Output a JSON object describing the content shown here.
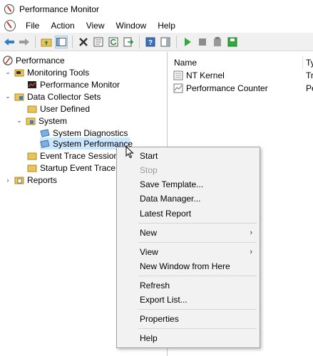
{
  "window": {
    "title": "Performance Monitor"
  },
  "menubar": {
    "items": [
      "File",
      "Action",
      "View",
      "Window",
      "Help"
    ]
  },
  "toolbar": {
    "buttons": [
      "back-arrow-icon",
      "forward-arrow-icon",
      "up-folder-icon",
      "show-hide-tree-icon",
      "delete-icon",
      "properties-icon",
      "refresh-icon",
      "export-icon",
      "help-icon",
      "show-hide-action-pane-icon",
      "start-icon",
      "stop-icon",
      "delete-set-icon",
      "save-template-icon"
    ]
  },
  "tree": {
    "items": [
      {
        "label": "Performance",
        "icon": "perfmon-icon",
        "expander": ""
      },
      {
        "label": "Monitoring Tools",
        "icon": "tools-folder-icon",
        "expander": "expanded"
      },
      {
        "label": "Performance Monitor",
        "icon": "graph-icon",
        "expander": ""
      },
      {
        "label": "Data Collector Sets",
        "icon": "collector-folder-icon",
        "expander": "expanded"
      },
      {
        "label": "User Defined",
        "icon": "folder-icon",
        "expander": ""
      },
      {
        "label": "System",
        "icon": "folder-icon",
        "expander": "expanded"
      },
      {
        "label": "System Diagnostics",
        "icon": "collector-set-icon",
        "expander": ""
      },
      {
        "label": "System Performance",
        "icon": "collector-set-icon",
        "expander": ""
      },
      {
        "label": "Event Trace Sessions",
        "icon": "folder-icon",
        "expander": ""
      },
      {
        "label": "Startup Event Trace Se",
        "icon": "folder-icon",
        "expander": ""
      },
      {
        "label": "Reports",
        "icon": "reports-icon",
        "expander": "collapsed"
      }
    ]
  },
  "list": {
    "columns": [
      "Name",
      "Ty"
    ],
    "rows": [
      {
        "name": "NT Kernel",
        "type": "Tr",
        "icon": "trace-icon"
      },
      {
        "name": "Performance Counter",
        "type": "Pe",
        "icon": "counter-icon"
      }
    ]
  },
  "context_menu": {
    "items": [
      {
        "label": "Start",
        "enabled": true
      },
      {
        "label": "Stop",
        "enabled": false
      },
      {
        "label": "Save Template...",
        "enabled": true
      },
      {
        "label": "Data Manager...",
        "enabled": true
      },
      {
        "label": "Latest Report",
        "enabled": true
      },
      {
        "label": "New",
        "enabled": true,
        "submenu": true
      },
      {
        "label": "View",
        "enabled": true,
        "submenu": true
      },
      {
        "label": "New Window from Here",
        "enabled": true
      },
      {
        "label": "Refresh",
        "enabled": true
      },
      {
        "label": "Export List...",
        "enabled": true
      },
      {
        "label": "Properties",
        "enabled": true
      },
      {
        "label": "Help",
        "enabled": true
      }
    ],
    "arrow_glyph": "›"
  },
  "colors": {
    "selection": "#cce8ff",
    "menu_bg": "#f2f2f2",
    "toolbar_bg": "#f0f0f0"
  }
}
